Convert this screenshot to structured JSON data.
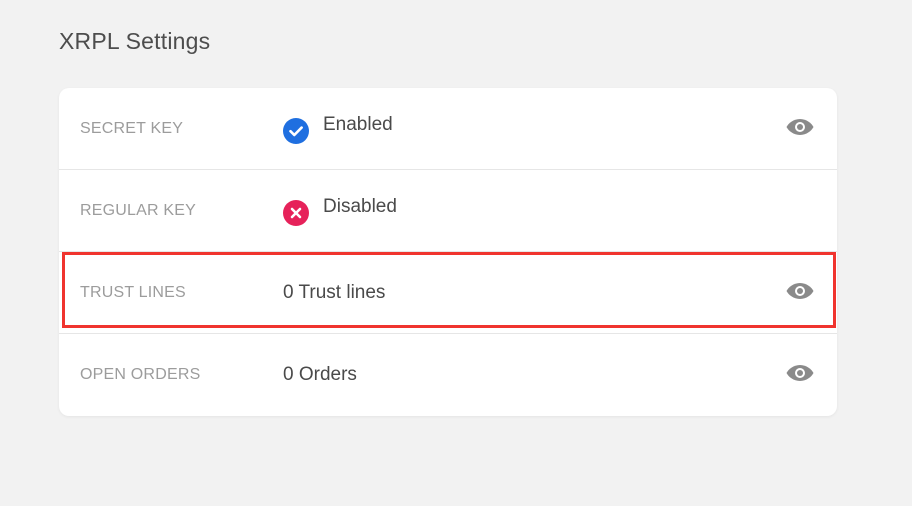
{
  "page": {
    "title": "XRPL Settings"
  },
  "settings": {
    "rows": [
      {
        "label": "SECRET KEY",
        "value": "Enabled",
        "status_icon": "check-circle-icon",
        "status_color": "#1f6fe0",
        "has_view": true,
        "action_icon": "eye-icon"
      },
      {
        "label": "REGULAR KEY",
        "value": "Disabled",
        "status_icon": "x-circle-icon",
        "status_color": "#e6225a",
        "has_view": false
      },
      {
        "label": "TRUST LINES",
        "value": "0 Trust lines",
        "has_view": true,
        "action_icon": "eye-icon",
        "highlighted": true
      },
      {
        "label": "OPEN ORDERS",
        "value": "0 Orders",
        "has_view": true,
        "action_icon": "eye-icon"
      }
    ]
  },
  "colors": {
    "background": "#f2f2f2",
    "card": "#ffffff",
    "label": "#9c9c9c",
    "value": "#4a4a4a",
    "icon_gray": "#8a8a8a",
    "highlight": "#f0342e"
  }
}
